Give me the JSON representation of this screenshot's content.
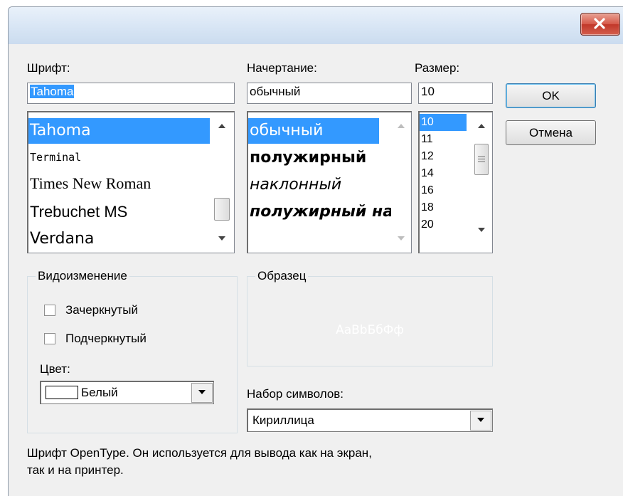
{
  "dialog": {
    "close_icon": "close-x-icon"
  },
  "font": {
    "label": "Шрифт:",
    "value": "Tahoma",
    "items": [
      "Tahoma",
      "Terminal",
      "Times New Roman",
      "Trebuchet MS",
      "Verdana"
    ],
    "selected": "Tahoma"
  },
  "style": {
    "label": "Начертание:",
    "value": "обычный",
    "items": [
      "обычный",
      "полужирный",
      "наклонный",
      "полужирный наклонный"
    ],
    "selected": "обычный"
  },
  "size": {
    "label": "Размер:",
    "value": "10",
    "items": [
      "10",
      "11",
      "12",
      "14",
      "16",
      "18",
      "20"
    ],
    "selected": "10"
  },
  "buttons": {
    "ok": "OK",
    "cancel": "Отмена"
  },
  "effects": {
    "title": "Видоизменение",
    "strikeout": "Зачеркнутый",
    "underline": "Подчеркнутый",
    "strikeout_checked": false,
    "underline_checked": false,
    "color_label": "Цвет:",
    "color_value": "Белый",
    "color_swatch": "#ffffff"
  },
  "sample": {
    "title": "Образец",
    "text": "AaBbБбФф",
    "text_color": "#ffffff"
  },
  "charset": {
    "label": "Набор символов:",
    "value": "Кириллица"
  },
  "description": {
    "line1": "Шрифт OpenType. Он используется для вывода как на экран,",
    "line2": "так и на принтер."
  },
  "colors": {
    "selection": "#3399ff",
    "dialog_bg": "#f0f0f0"
  }
}
